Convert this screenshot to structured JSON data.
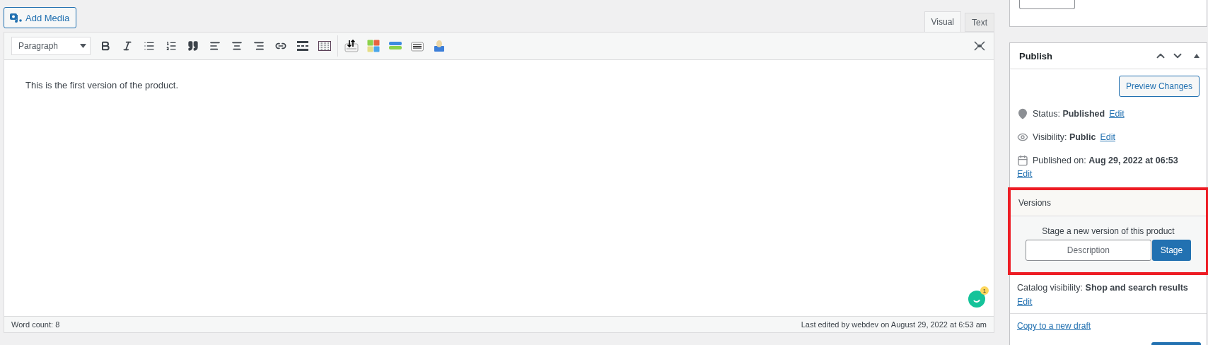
{
  "add_media": {
    "label": "Add Media"
  },
  "editor_tabs": [
    {
      "label": "Visual",
      "selected": true
    },
    {
      "label": "Text",
      "selected": false
    }
  ],
  "format_select": {
    "value": "Paragraph"
  },
  "content": "This is the first version of the product.",
  "notification_badge": "1",
  "status_bar": {
    "word_count": "Word count: 8",
    "last_edited": "Last edited by webdev on August 29, 2022 at 6:53 am"
  },
  "publish": {
    "title": "Publish",
    "preview_button": "Preview Changes",
    "rows": [
      {
        "kind": "status",
        "text": "Status: **Published**",
        "link": "Edit"
      },
      {
        "kind": "visibility",
        "text": "Visibility: **Public**",
        "link": "Edit"
      },
      {
        "kind": "date",
        "text": "Published on: **Aug 29, 2022 at 06:53**",
        "link": "Edit"
      }
    ]
  },
  "versions": {
    "title": "Versions",
    "prompt": "Stage a new version of this product",
    "placeholder": "Description",
    "button": "Stage"
  },
  "catalog": {
    "text": "Catalog visibility: **Shop and search results**",
    "link": "Edit"
  },
  "copy_link": "Copy to a new draft"
}
